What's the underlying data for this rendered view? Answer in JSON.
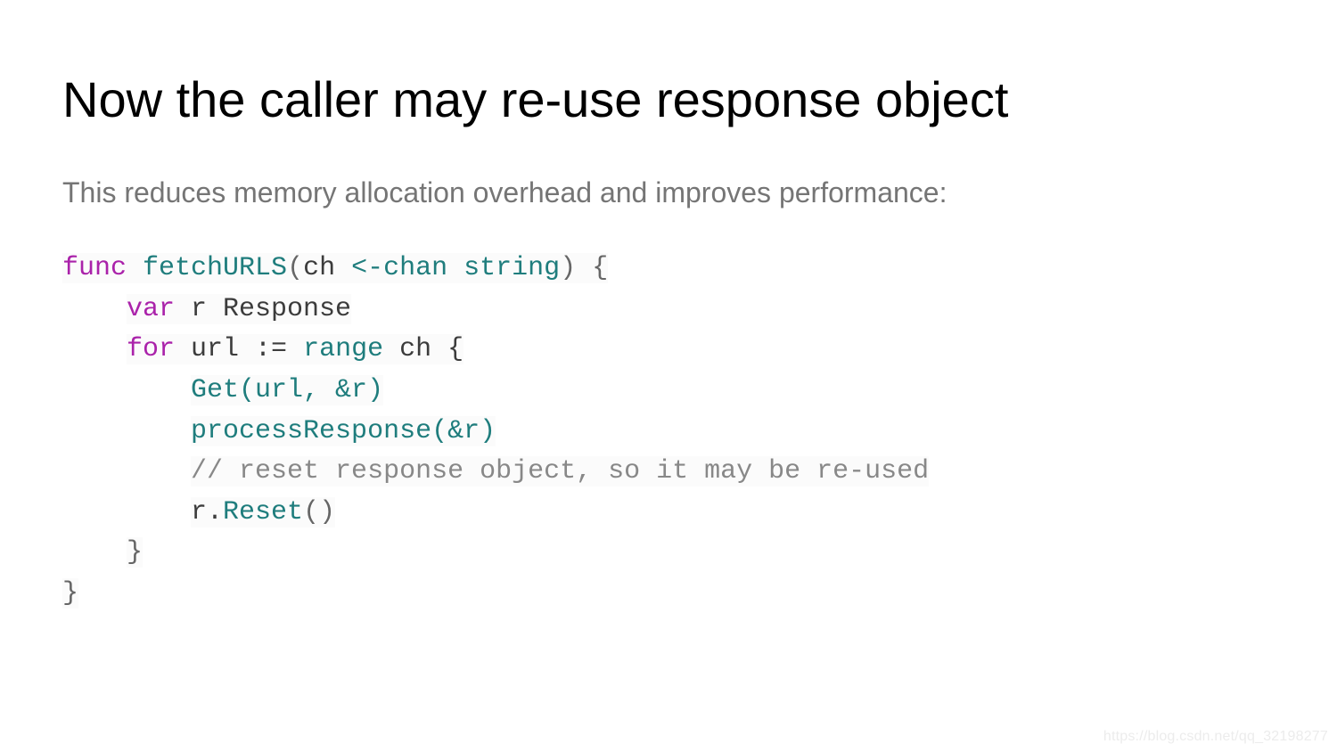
{
  "title": "Now the caller may re-use response object",
  "subtitle": "This reduces memory allocation overhead and improves performance:",
  "code": {
    "l1_func": "func",
    "l1_name": "fetchURLS",
    "l1_paren_open": "(",
    "l1_arg": "ch",
    "l1_chan": "<-chan",
    "l1_type": "string",
    "l1_paren_close": ")",
    "l1_brace": " {",
    "l2_var": "var",
    "l2_rest": " r Response",
    "l3_for": "for",
    "l3_mid": " url := ",
    "l3_range": "range",
    "l3_rest": " ch {",
    "l4": "Get(url, &r)",
    "l5": "processResponse(&r)",
    "l6": "// reset response object, so it may be re-used",
    "l7_r": "r.",
    "l7_reset": "Reset",
    "l7_paren": "()",
    "l8": "}",
    "l9": "}"
  },
  "watermark": "https://blog.csdn.net/qq_32198277"
}
